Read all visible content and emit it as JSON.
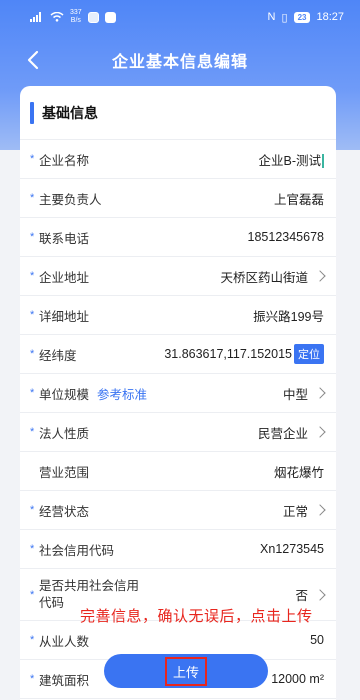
{
  "status_bar": {
    "net_speed": "337",
    "net_unit": "B/s",
    "signal": "N",
    "battery": "23",
    "time": "18:27"
  },
  "header": {
    "title": "企业基本信息编辑",
    "back_icon": "chevron-left-icon"
  },
  "section": {
    "title": "基础信息"
  },
  "fields": [
    {
      "label": "企业名称",
      "value": "企业B-测试",
      "required": true
    },
    {
      "label": "主要负责人",
      "value": "上官磊磊",
      "required": true
    },
    {
      "label": "联系电话",
      "value": "18512345678",
      "required": true
    },
    {
      "label": "企业地址",
      "value": "天桥区药山街道",
      "required": true
    },
    {
      "label": "详细地址",
      "value": "振兴路199号",
      "required": true
    },
    {
      "label": "经纬度",
      "value": "31.863617,117.152015",
      "action": "定位",
      "required": true
    },
    {
      "label": "单位规模",
      "link": "参考标准",
      "value": "中型",
      "required": true
    },
    {
      "label": "法人性质",
      "value": "民营企业",
      "required": true
    },
    {
      "label": "营业范围",
      "value": "烟花爆竹",
      "required": false
    },
    {
      "label": "经营状态",
      "value": "正常",
      "required": true
    },
    {
      "label": "社会信用代码",
      "value": "Xn1273545",
      "required": true
    },
    {
      "label": "是否共用社会信用代码",
      "value": "否",
      "required": true
    },
    {
      "label": "从业人数",
      "value": "50",
      "required": true
    },
    {
      "label": "建筑面积",
      "value": "12000 m²",
      "required": true
    }
  ],
  "annotation": "完善信息，确认无误后，点击上传",
  "upload_button": "上传",
  "colors": {
    "accent": "#3a74f2",
    "header_gradient_top": "#4f86f7",
    "annotation_red": "#e8261e"
  }
}
